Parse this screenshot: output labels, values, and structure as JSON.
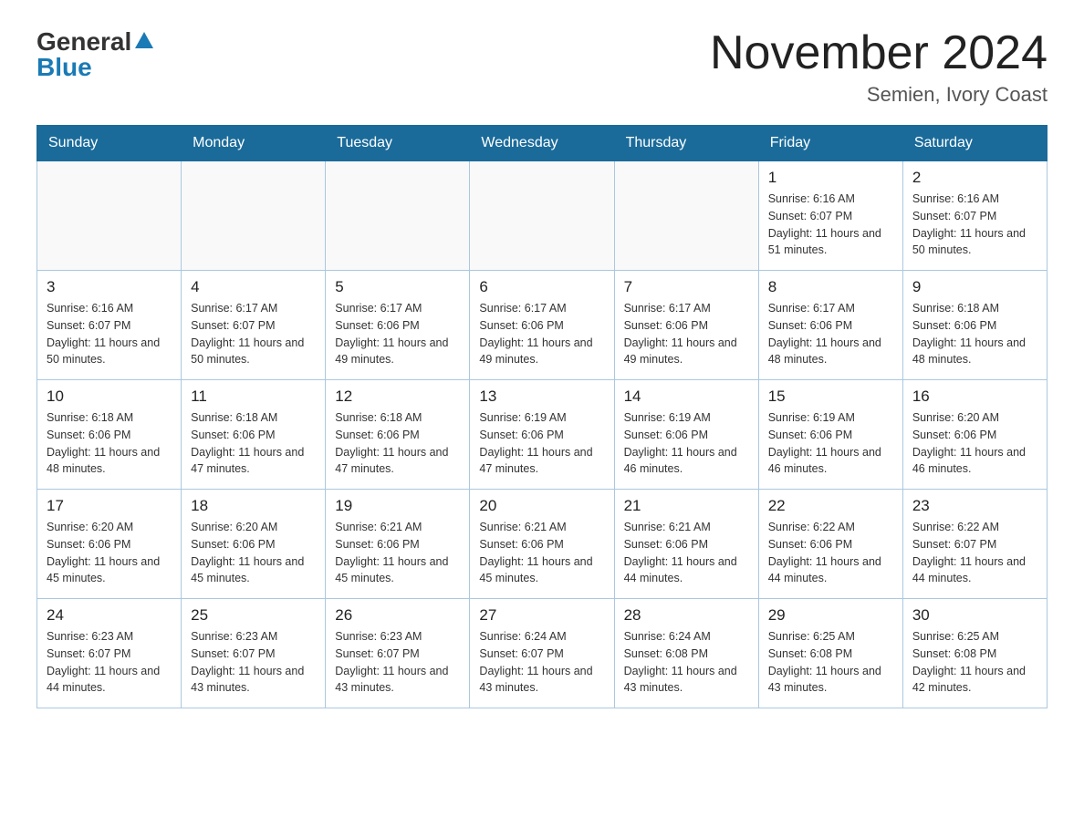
{
  "logo": {
    "general": "General",
    "blue": "Blue"
  },
  "header": {
    "month": "November 2024",
    "location": "Semien, Ivory Coast"
  },
  "days_of_week": [
    "Sunday",
    "Monday",
    "Tuesday",
    "Wednesday",
    "Thursday",
    "Friday",
    "Saturday"
  ],
  "weeks": [
    [
      {
        "day": "",
        "info": ""
      },
      {
        "day": "",
        "info": ""
      },
      {
        "day": "",
        "info": ""
      },
      {
        "day": "",
        "info": ""
      },
      {
        "day": "",
        "info": ""
      },
      {
        "day": "1",
        "info": "Sunrise: 6:16 AM\nSunset: 6:07 PM\nDaylight: 11 hours and 51 minutes."
      },
      {
        "day": "2",
        "info": "Sunrise: 6:16 AM\nSunset: 6:07 PM\nDaylight: 11 hours and 50 minutes."
      }
    ],
    [
      {
        "day": "3",
        "info": "Sunrise: 6:16 AM\nSunset: 6:07 PM\nDaylight: 11 hours and 50 minutes."
      },
      {
        "day": "4",
        "info": "Sunrise: 6:17 AM\nSunset: 6:07 PM\nDaylight: 11 hours and 50 minutes."
      },
      {
        "day": "5",
        "info": "Sunrise: 6:17 AM\nSunset: 6:06 PM\nDaylight: 11 hours and 49 minutes."
      },
      {
        "day": "6",
        "info": "Sunrise: 6:17 AM\nSunset: 6:06 PM\nDaylight: 11 hours and 49 minutes."
      },
      {
        "day": "7",
        "info": "Sunrise: 6:17 AM\nSunset: 6:06 PM\nDaylight: 11 hours and 49 minutes."
      },
      {
        "day": "8",
        "info": "Sunrise: 6:17 AM\nSunset: 6:06 PM\nDaylight: 11 hours and 48 minutes."
      },
      {
        "day": "9",
        "info": "Sunrise: 6:18 AM\nSunset: 6:06 PM\nDaylight: 11 hours and 48 minutes."
      }
    ],
    [
      {
        "day": "10",
        "info": "Sunrise: 6:18 AM\nSunset: 6:06 PM\nDaylight: 11 hours and 48 minutes."
      },
      {
        "day": "11",
        "info": "Sunrise: 6:18 AM\nSunset: 6:06 PM\nDaylight: 11 hours and 47 minutes."
      },
      {
        "day": "12",
        "info": "Sunrise: 6:18 AM\nSunset: 6:06 PM\nDaylight: 11 hours and 47 minutes."
      },
      {
        "day": "13",
        "info": "Sunrise: 6:19 AM\nSunset: 6:06 PM\nDaylight: 11 hours and 47 minutes."
      },
      {
        "day": "14",
        "info": "Sunrise: 6:19 AM\nSunset: 6:06 PM\nDaylight: 11 hours and 46 minutes."
      },
      {
        "day": "15",
        "info": "Sunrise: 6:19 AM\nSunset: 6:06 PM\nDaylight: 11 hours and 46 minutes."
      },
      {
        "day": "16",
        "info": "Sunrise: 6:20 AM\nSunset: 6:06 PM\nDaylight: 11 hours and 46 minutes."
      }
    ],
    [
      {
        "day": "17",
        "info": "Sunrise: 6:20 AM\nSunset: 6:06 PM\nDaylight: 11 hours and 45 minutes."
      },
      {
        "day": "18",
        "info": "Sunrise: 6:20 AM\nSunset: 6:06 PM\nDaylight: 11 hours and 45 minutes."
      },
      {
        "day": "19",
        "info": "Sunrise: 6:21 AM\nSunset: 6:06 PM\nDaylight: 11 hours and 45 minutes."
      },
      {
        "day": "20",
        "info": "Sunrise: 6:21 AM\nSunset: 6:06 PM\nDaylight: 11 hours and 45 minutes."
      },
      {
        "day": "21",
        "info": "Sunrise: 6:21 AM\nSunset: 6:06 PM\nDaylight: 11 hours and 44 minutes."
      },
      {
        "day": "22",
        "info": "Sunrise: 6:22 AM\nSunset: 6:06 PM\nDaylight: 11 hours and 44 minutes."
      },
      {
        "day": "23",
        "info": "Sunrise: 6:22 AM\nSunset: 6:07 PM\nDaylight: 11 hours and 44 minutes."
      }
    ],
    [
      {
        "day": "24",
        "info": "Sunrise: 6:23 AM\nSunset: 6:07 PM\nDaylight: 11 hours and 44 minutes."
      },
      {
        "day": "25",
        "info": "Sunrise: 6:23 AM\nSunset: 6:07 PM\nDaylight: 11 hours and 43 minutes."
      },
      {
        "day": "26",
        "info": "Sunrise: 6:23 AM\nSunset: 6:07 PM\nDaylight: 11 hours and 43 minutes."
      },
      {
        "day": "27",
        "info": "Sunrise: 6:24 AM\nSunset: 6:07 PM\nDaylight: 11 hours and 43 minutes."
      },
      {
        "day": "28",
        "info": "Sunrise: 6:24 AM\nSunset: 6:08 PM\nDaylight: 11 hours and 43 minutes."
      },
      {
        "day": "29",
        "info": "Sunrise: 6:25 AM\nSunset: 6:08 PM\nDaylight: 11 hours and 43 minutes."
      },
      {
        "day": "30",
        "info": "Sunrise: 6:25 AM\nSunset: 6:08 PM\nDaylight: 11 hours and 42 minutes."
      }
    ]
  ]
}
